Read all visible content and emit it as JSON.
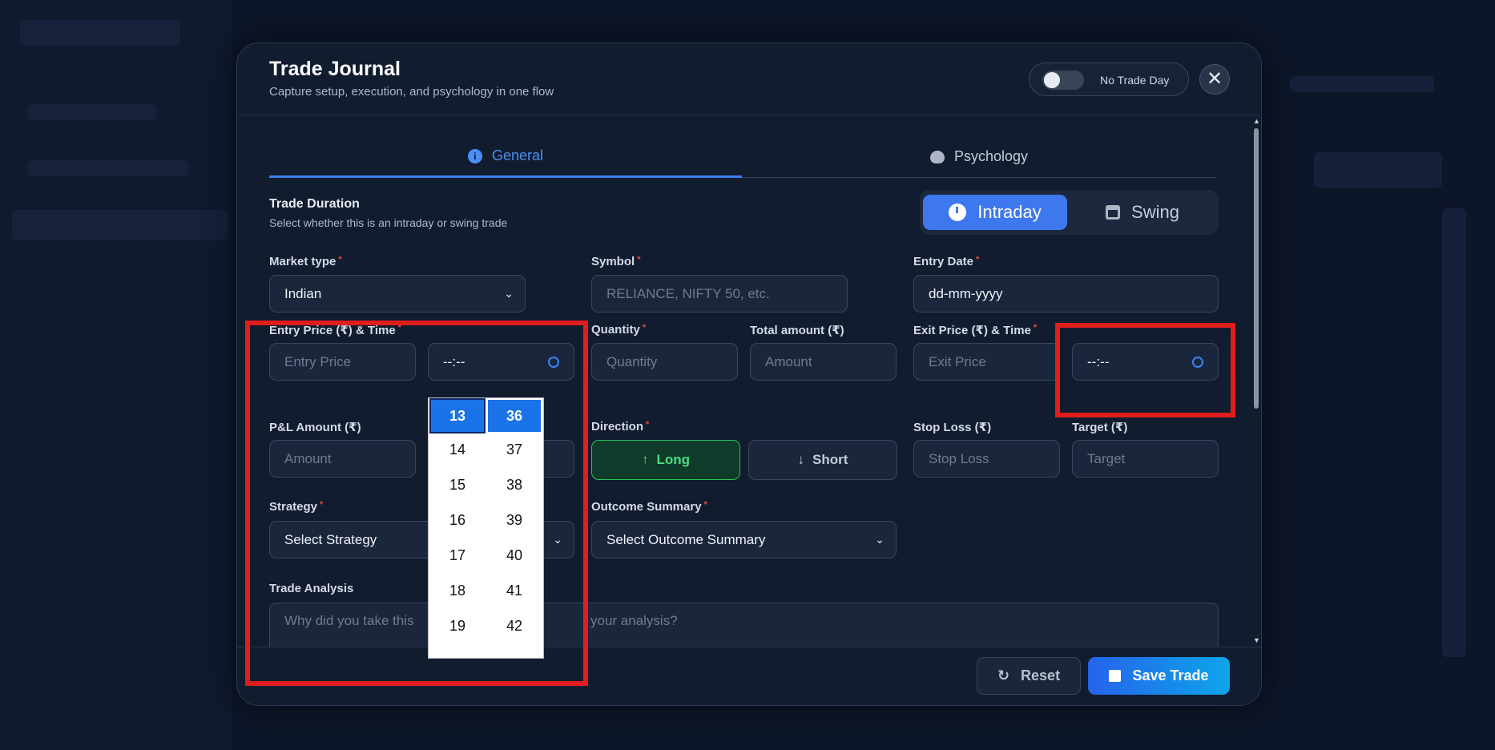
{
  "modal": {
    "title": "Trade Journal",
    "subtitle": "Capture setup, execution, and psychology in one flow",
    "no_trade_day_label": "No Trade Day",
    "close_glyph": "✕"
  },
  "tabs": [
    {
      "label": "General",
      "icon": "info-icon",
      "active": true
    },
    {
      "label": "Psychology",
      "icon": "brain-icon",
      "active": false
    }
  ],
  "trade_duration": {
    "title": "Trade Duration",
    "subtitle": "Select whether this is an intraday or swing trade",
    "options": [
      "Intraday",
      "Swing"
    ],
    "selected": "Intraday"
  },
  "fields": {
    "market_type": {
      "label": "Market type",
      "value": "Indian"
    },
    "symbol": {
      "label": "Symbol",
      "placeholder": "RELIANCE, NIFTY 50, etc."
    },
    "entry_date": {
      "label": "Entry Date",
      "value": "dd-mm-yyyy"
    },
    "entry_price_time": {
      "label": "Entry Price (₹) & Time",
      "price_placeholder": "Entry Price",
      "time_value": "--:--"
    },
    "quantity": {
      "label": "Quantity",
      "placeholder": "Quantity"
    },
    "total_amount": {
      "label": "Total amount (₹)",
      "placeholder": "Amount"
    },
    "exit_price_time": {
      "label": "Exit Price (₹) & Time",
      "price_placeholder": "Exit Price",
      "time_value": "--:--"
    },
    "pnl_amount": {
      "label": "P&L Amount (₹)",
      "placeholder": "Amount"
    },
    "direction": {
      "label": "Direction",
      "long": "Long",
      "short": "Short",
      "selected": "Long"
    },
    "stop_loss": {
      "label": "Stop Loss (₹)",
      "placeholder": "Stop Loss"
    },
    "target": {
      "label": "Target (₹)",
      "placeholder": "Target"
    },
    "strategy": {
      "label": "Strategy",
      "value": "Select Strategy"
    },
    "outcome_summary": {
      "label": "Outcome Summary",
      "value": "Select Outcome Summary"
    },
    "trade_analysis": {
      "label": "Trade Analysis",
      "placeholder_visible_left": "Why did you take this",
      "placeholder_visible_right": "your analysis?"
    }
  },
  "time_picker": {
    "hours": [
      "13",
      "14",
      "15",
      "16",
      "17",
      "18",
      "19"
    ],
    "minutes": [
      "36",
      "37",
      "38",
      "39",
      "40",
      "41",
      "42"
    ],
    "selected_hour": "13",
    "selected_minute": "36"
  },
  "footer": {
    "reset_label": "Reset",
    "save_label": "Save Trade"
  },
  "colors": {
    "accent": "#3d78ee",
    "long": "#4ade80",
    "required": "#ef4444",
    "highlight": "#e11d1d"
  }
}
